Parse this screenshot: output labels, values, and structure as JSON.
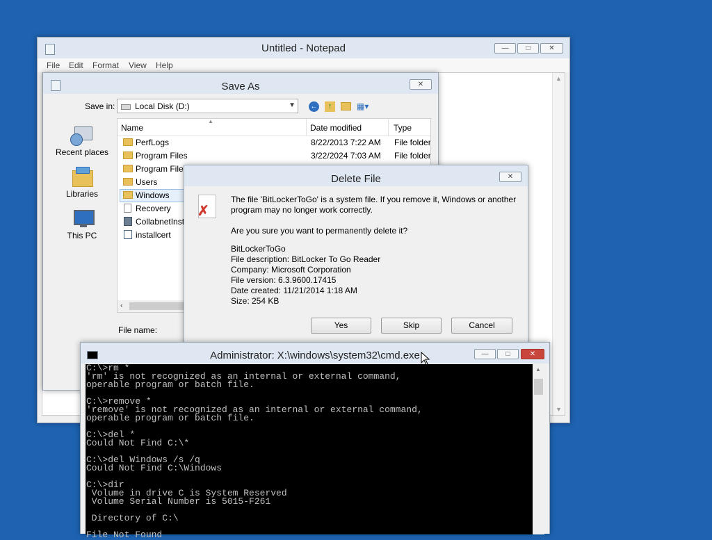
{
  "notepad": {
    "title": "Untitled - Notepad",
    "menu": [
      "File",
      "Edit",
      "Format",
      "View",
      "Help"
    ]
  },
  "save_as": {
    "title": "Save As",
    "save_in_label": "Save in:",
    "save_in_value": "Local Disk (D:)",
    "places": [
      "Recent places",
      "Libraries",
      "This PC"
    ],
    "columns": [
      "Name",
      "Date modified",
      "Type"
    ],
    "files": [
      {
        "name": "PerfLogs",
        "date": "8/22/2013 7:22 AM",
        "type": "File folder",
        "kind": "folder"
      },
      {
        "name": "Program Files",
        "date": "3/22/2024 7:03 AM",
        "type": "File folder",
        "kind": "folder"
      },
      {
        "name": "Program Files",
        "date": "",
        "type": "",
        "kind": "folder"
      },
      {
        "name": "Users",
        "date": "",
        "type": "",
        "kind": "folder"
      },
      {
        "name": "Windows",
        "date": "",
        "type": "",
        "kind": "folder"
      },
      {
        "name": "Recovery",
        "date": "",
        "type": "",
        "kind": "file"
      },
      {
        "name": "CollabnetInst",
        "date": "",
        "type": "",
        "kind": "file"
      },
      {
        "name": "installcert",
        "date": "",
        "type": "",
        "kind": "file"
      }
    ],
    "file_name_label": "File name:"
  },
  "delete_dialog": {
    "title": "Delete File",
    "message": "The file 'BitLockerToGo' is a system file. If you remove it, Windows or another program may no longer work correctly.",
    "question": "Are you sure you want to permanently delete it?",
    "details": [
      "BitLockerToGo",
      "File description: BitLocker To Go Reader",
      "Company: Microsoft Corporation",
      "File version: 6.3.9600.17415",
      "Date created: 11/21/2014 1:18 AM",
      "Size: 254 KB"
    ],
    "buttons": {
      "yes": "Yes",
      "skip": "Skip",
      "cancel": "Cancel"
    }
  },
  "cmd": {
    "title": "Administrator: X:\\windows\\system32\\cmd.exe",
    "lines": [
      "C:\\>rm *",
      "'rm' is not recognized as an internal or external command,",
      "operable program or batch file.",
      "",
      "C:\\>remove *",
      "'remove' is not recognized as an internal or external command,",
      "operable program or batch file.",
      "",
      "C:\\>del *",
      "Could Not Find C:\\*",
      "",
      "C:\\>del Windows /s /q",
      "Could Not Find C:\\Windows",
      "",
      "C:\\>dir",
      " Volume in drive C is System Reserved",
      " Volume Serial Number is 5015-F261",
      "",
      " Directory of C:\\",
      "",
      "File Not Found"
    ]
  },
  "colors": {
    "desktop": "#1e63b2",
    "titlebar": "#dfe8f2",
    "close_button": "#c9463d",
    "console_bg": "#000000",
    "console_text": "#c0c0c0"
  }
}
